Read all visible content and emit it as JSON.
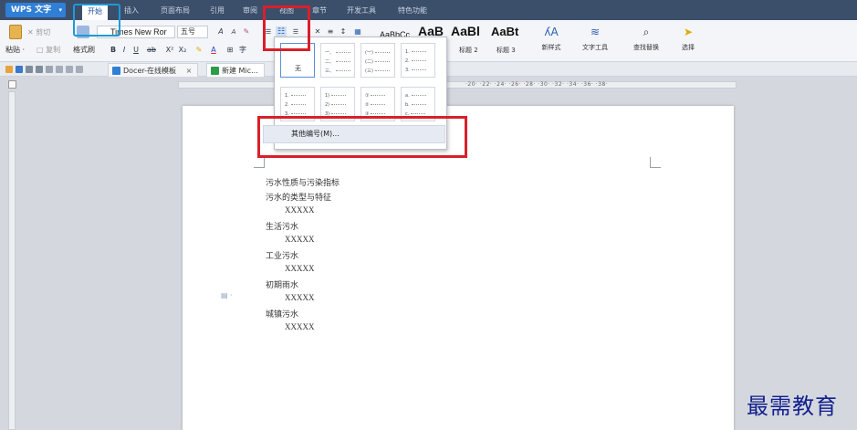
{
  "app": {
    "name": "WPS 文字",
    "arrow": "▾"
  },
  "menu": {
    "tabs": [
      {
        "label": "开始",
        "active": true
      },
      {
        "label": "插入"
      },
      {
        "label": "页面布局"
      },
      {
        "label": "引用"
      },
      {
        "label": "审阅"
      },
      {
        "label": "视图"
      },
      {
        "label": "章节"
      },
      {
        "label": "开发工具"
      },
      {
        "label": "特色功能"
      }
    ]
  },
  "ribbon": {
    "cut": "✕ 剪切",
    "paste": "粘贴 ·",
    "copy": "□ 复制",
    "format_painter": "格式刷",
    "font_name": "Times New Ror",
    "font_size": "五号",
    "grow": "A",
    "shrink": "A",
    "bold": "B",
    "italic": "I",
    "underline": "U",
    "strike": "ab",
    "superscript": "X²",
    "subscript": "X₂",
    "highlight": "✎",
    "font_color": "A",
    "border": "⊞",
    "char_format": "字",
    "styles": [
      {
        "preview": "AaBbCc",
        "label": ""
      },
      {
        "preview": "AaB",
        "label": ""
      },
      {
        "preview": "AaBl",
        "label": "标题 2"
      },
      {
        "preview": "AaBt",
        "label": "标题 3"
      }
    ],
    "new_style": "新样式",
    "text_tools": "文字工具",
    "find_replace": "查找替换",
    "select": "选择"
  },
  "tabs_bar": {
    "tabs": [
      {
        "label": "Docer-在线模板",
        "close": "×"
      },
      {
        "label": "新建 Mic...",
        "close": ""
      }
    ]
  },
  "ruler": {
    "numbers": "·20· ·22· ·24· ·26· ·28· ·30· ·32· ·34· ·36· ·38·"
  },
  "numbering_dropdown": {
    "none_label": "无",
    "more_label": "其他编号(M)...",
    "cells": [
      {
        "rows": [
          "一、",
          "二、",
          "三、"
        ]
      },
      {
        "rows": [
          "(一)",
          "(二)",
          "(三)"
        ]
      },
      {
        "rows": [
          "1.",
          "2.",
          "3."
        ]
      },
      {
        "rows": [
          "1.",
          "2.",
          "3."
        ]
      },
      {
        "rows": [
          "1)",
          "2)",
          "3)"
        ]
      },
      {
        "rows": [
          "①",
          "②",
          "③"
        ]
      },
      {
        "rows": [
          "a.",
          "b.",
          "c."
        ]
      }
    ]
  },
  "document": {
    "lines": [
      {
        "text": "污水性质与污染指标",
        "kind": "heading"
      },
      {
        "text": "污水的类型与特征",
        "kind": "heading"
      },
      {
        "text": "XXXXX",
        "kind": "sub"
      },
      {
        "text": "生活污水",
        "kind": "heading"
      },
      {
        "text": "XXXXX",
        "kind": "sub"
      },
      {
        "text": "工业污水",
        "kind": "heading"
      },
      {
        "text": "XXXXX",
        "kind": "sub"
      },
      {
        "text": "初期雨水",
        "kind": "heading"
      },
      {
        "text": "XXXXX",
        "kind": "sub"
      },
      {
        "text": "城镇污水",
        "kind": "heading"
      },
      {
        "text": "XXXXX",
        "kind": "sub"
      }
    ]
  },
  "watermark": "最需教育",
  "colors": {
    "menubar": "#3b4f6b",
    "highlight_blue": "#1e9ad6",
    "highlight_red": "#d8202a",
    "watermark": "#13208f"
  }
}
